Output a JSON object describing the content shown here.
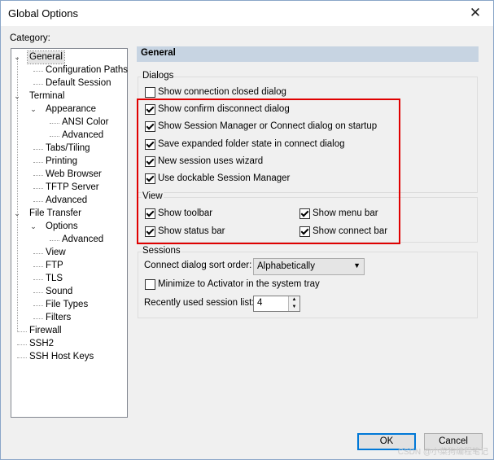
{
  "window": {
    "title": "Global Options",
    "close_symbol": "✕"
  },
  "category_label": "Category:",
  "tree": [
    {
      "label": "General",
      "level": 0,
      "expander": "minus",
      "selected": true
    },
    {
      "label": "Configuration Paths",
      "level": 1
    },
    {
      "label": "Default Session",
      "level": 1
    },
    {
      "label": "Terminal",
      "level": 0,
      "expander": "minus"
    },
    {
      "label": "Appearance",
      "level": 1,
      "expander": "minus"
    },
    {
      "label": "ANSI Color",
      "level": 2
    },
    {
      "label": "Advanced",
      "level": 2
    },
    {
      "label": "Tabs/Tiling",
      "level": 1
    },
    {
      "label": "Printing",
      "level": 1
    },
    {
      "label": "Web Browser",
      "level": 1
    },
    {
      "label": "TFTP Server",
      "level": 1
    },
    {
      "label": "Advanced",
      "level": 1
    },
    {
      "label": "File Transfer",
      "level": 0,
      "expander": "minus"
    },
    {
      "label": "Options",
      "level": 1,
      "expander": "minus"
    },
    {
      "label": "Advanced",
      "level": 2
    },
    {
      "label": "View",
      "level": 1
    },
    {
      "label": "FTP",
      "level": 1
    },
    {
      "label": "TLS",
      "level": 1
    },
    {
      "label": "Sound",
      "level": 1
    },
    {
      "label": "File Types",
      "level": 1
    },
    {
      "label": "Filters",
      "level": 1
    },
    {
      "label": "Firewall",
      "level": 0
    },
    {
      "label": "SSH2",
      "level": 0
    },
    {
      "label": "SSH Host Keys",
      "level": 0
    }
  ],
  "panel": {
    "title": "General",
    "dialogs": {
      "label": "Dialogs",
      "items": [
        {
          "label": "Show connection closed dialog",
          "checked": false
        },
        {
          "label": "Show confirm disconnect dialog",
          "checked": true
        },
        {
          "label": "Show Session Manager or Connect dialog on startup",
          "checked": true
        },
        {
          "label": "Save expanded folder state in connect dialog",
          "checked": true
        },
        {
          "label": "New session uses wizard",
          "checked": true
        },
        {
          "label": "Use dockable Session Manager",
          "checked": true
        }
      ]
    },
    "view": {
      "label": "View",
      "items": [
        {
          "label": "Show toolbar",
          "checked": true
        },
        {
          "label": "Show menu bar",
          "checked": true
        },
        {
          "label": "Show status bar",
          "checked": true
        },
        {
          "label": "Show connect bar",
          "checked": true
        }
      ]
    },
    "sessions": {
      "label": "Sessions",
      "sort_label": "Connect dialog sort order:",
      "sort_value": "Alphabetically",
      "minimize_label": "Minimize to Activator in the system tray",
      "minimize_checked": false,
      "recent_label": "Recently used session list:",
      "recent_value": "4"
    }
  },
  "buttons": {
    "ok": "OK",
    "cancel": "Cancel"
  },
  "watermark": "CSDN @小菜狗编程笔记",
  "colors": {
    "highlight_border": "#e00000",
    "header_bg": "#c7d4e2",
    "ok_border": "#0078d7"
  }
}
